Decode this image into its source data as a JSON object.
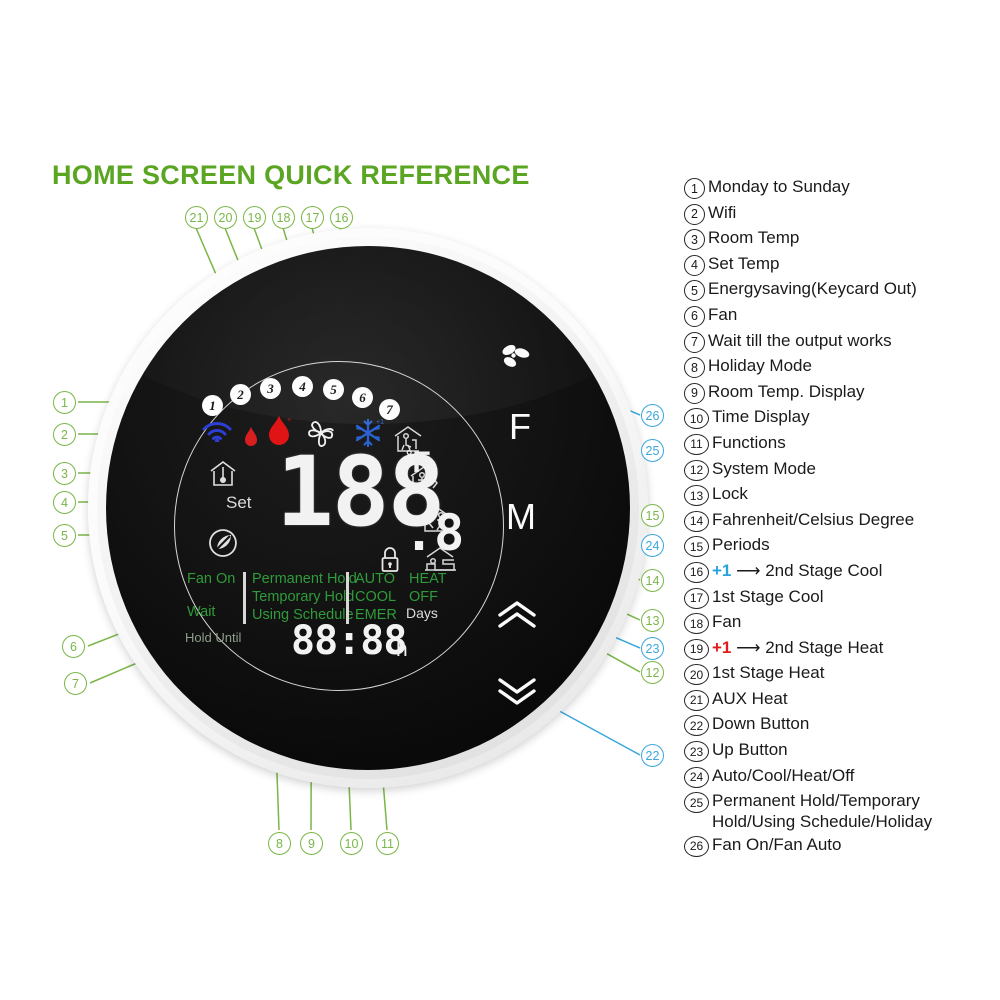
{
  "page": {
    "title": "HOME SCREEN QUICK REFERENCE",
    "accent_green": "#7ab648",
    "accent_blue": "#3aa6dd",
    "title_color": "#5aa521"
  },
  "device": {
    "display": {
      "main_value": "188",
      "decimal": ".8",
      "degree_symbol": "°",
      "unit": "F",
      "set_label": "Set",
      "clock_value": "88:88",
      "clock_hour_unit": "h",
      "days_label": "Days",
      "top_numbers": [
        "1",
        "2",
        "3",
        "4",
        "5",
        "6",
        "7"
      ],
      "status_texts": {
        "fan_on": "Fan On",
        "wait": "Wait",
        "hold_until": "Hold Until",
        "permanent_hold": "Permanent Hold",
        "temporary_hold": "Temporary Hold",
        "using_schedule": "Using Schedule",
        "auto": "AUTO",
        "cool": "COOL",
        "emer": "EMER",
        "heat": "HEAT",
        "off": "OFF"
      },
      "icons": [
        {
          "name": "wifi-icon",
          "color": "#2b3fd4"
        },
        {
          "name": "flame-small-icon",
          "color": "#d81f1f"
        },
        {
          "name": "flame-large-icon",
          "color": "#e01414"
        },
        {
          "name": "fan-blades-icon",
          "color": "#f2f2f2"
        },
        {
          "name": "snowflake-icon",
          "color": "#2b63d4"
        },
        {
          "name": "home-thermometer-icon",
          "color": "#e0e0e0"
        },
        {
          "name": "energy-saving-icon",
          "color": "#e0e0e0"
        },
        {
          "name": "period-wake-icon",
          "color": "#d8d8d8"
        },
        {
          "name": "period-leave-icon",
          "color": "#d8d8d8"
        },
        {
          "name": "period-return-icon",
          "color": "#d8d8d8"
        },
        {
          "name": "period-sleep-icon",
          "color": "#d8d8d8"
        },
        {
          "name": "lock-icon",
          "color": "#e8e8e8"
        }
      ]
    },
    "keys": {
      "fan_key": "fan-propeller-icon",
      "f_key": "F",
      "m_key": "M",
      "up_key": "chevron-up-icon",
      "down_key": "chevron-down-icon"
    }
  },
  "callouts": {
    "top": [
      "21",
      "20",
      "19",
      "18",
      "17",
      "16"
    ],
    "left": [
      "1",
      "2",
      "3",
      "4",
      "5",
      "6",
      "7"
    ],
    "bottom": [
      "8",
      "9",
      "10",
      "11"
    ],
    "right": [
      "26",
      "25",
      "15",
      "24",
      "14",
      "13",
      "23",
      "12",
      "22"
    ]
  },
  "legend": {
    "items": [
      {
        "num": "1",
        "text": "Monday to Sunday"
      },
      {
        "num": "2",
        "text": "Wifi"
      },
      {
        "num": "3",
        "text": "Room Temp"
      },
      {
        "num": "4",
        "text": "Set Temp"
      },
      {
        "num": "5",
        "text": "Energysaving(Keycard Out)"
      },
      {
        "num": "6",
        "text": "Fan"
      },
      {
        "num": "7",
        "text": "Wait till the output works"
      },
      {
        "num": "8",
        "text": "Holiday Mode"
      },
      {
        "num": "9",
        "text": "Room Temp. Display"
      },
      {
        "num": "10",
        "text": "Time Display"
      },
      {
        "num": "11",
        "text": "Functions"
      },
      {
        "num": "12",
        "text": "System Mode"
      },
      {
        "num": "13",
        "text": "Lock"
      },
      {
        "num": "14",
        "text": "Fahrenheit/Celsius Degree"
      },
      {
        "num": "15",
        "text": "Periods"
      },
      {
        "num": "16",
        "text": "+1 ⟶  2nd Stage Cool",
        "prefix": "+1",
        "prefix_color": "#29a3dc",
        "rest": " ⟶  2nd Stage Cool"
      },
      {
        "num": "17",
        "text": "1st Stage Cool"
      },
      {
        "num": "18",
        "text": "Fan"
      },
      {
        "num": "19",
        "text": "+1 ⟶  2nd Stage Heat",
        "prefix": "+1",
        "prefix_color": "#e11b1b",
        "rest": " ⟶  2nd Stage Heat"
      },
      {
        "num": "20",
        "text": "1st Stage Heat"
      },
      {
        "num": "21",
        "text": "AUX Heat"
      },
      {
        "num": "22",
        "text": "Down Button"
      },
      {
        "num": "23",
        "text": "Up Button"
      },
      {
        "num": "24",
        "text": "Auto/Cool/Heat/Off"
      },
      {
        "num": "25",
        "text": "Permanent Hold/Temporary",
        "text2": "Hold/Using Schedule/Holiday"
      },
      {
        "num": "26",
        "text": "Fan On/Fan Auto"
      }
    ]
  }
}
